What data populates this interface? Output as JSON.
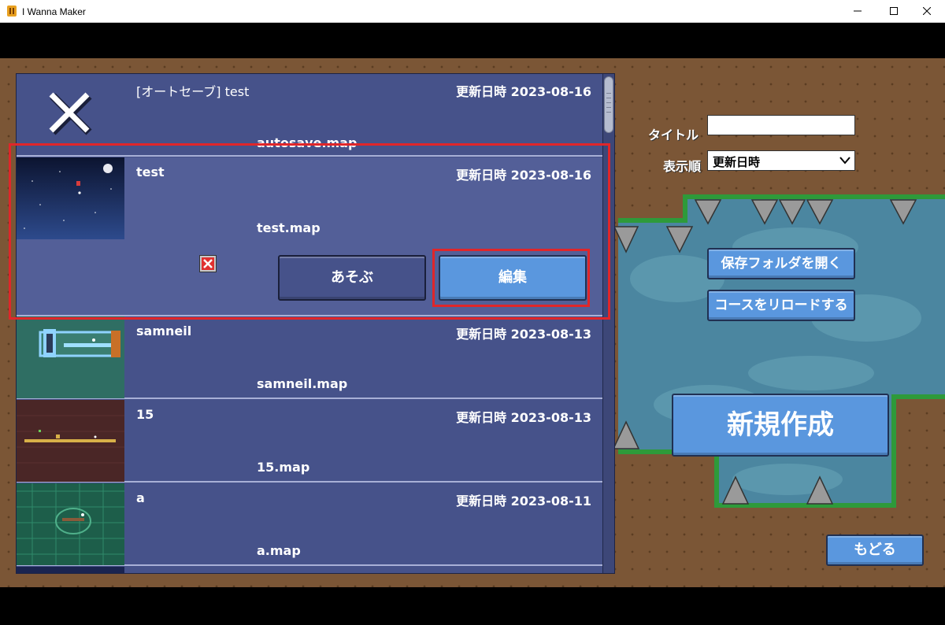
{
  "window": {
    "title": "I Wanna Maker",
    "minimize_icon": "minimize-icon",
    "maximize_icon": "maximize-icon",
    "close_icon": "close-icon"
  },
  "course_list": {
    "items": [
      {
        "name": "[オートセーブ] test",
        "updated": "更新日時 2023-08-16",
        "file": "autosave.map",
        "thumbnail": "x-mark-icon"
      },
      {
        "name": "test",
        "updated": "更新日時 2023-08-16",
        "file": "test.map",
        "selected": true,
        "delete_icon": "delete-x-icon",
        "play_label": "あそぶ",
        "edit_label": "編集"
      },
      {
        "name": "samneil",
        "updated": "更新日時 2023-08-13",
        "file": "samneil.map"
      },
      {
        "name": "15",
        "updated": "更新日時 2023-08-13",
        "file": "15.map"
      },
      {
        "name": "a",
        "updated": "更新日時 2023-08-11",
        "file": "a.map"
      }
    ]
  },
  "filters": {
    "title_label": "タイトル",
    "title_value": "",
    "sort_label": "表示順",
    "sort_value": "更新日時"
  },
  "actions": {
    "open_folder": "保存フォルダを開く",
    "reload": "コースをリロードする",
    "new": "新規作成",
    "back": "もどる"
  },
  "colors": {
    "panel": "#46528a",
    "button": "#5a97de",
    "highlight": "#e0262a",
    "dirt": "#7b5636",
    "grass": "#2e9a3a"
  }
}
